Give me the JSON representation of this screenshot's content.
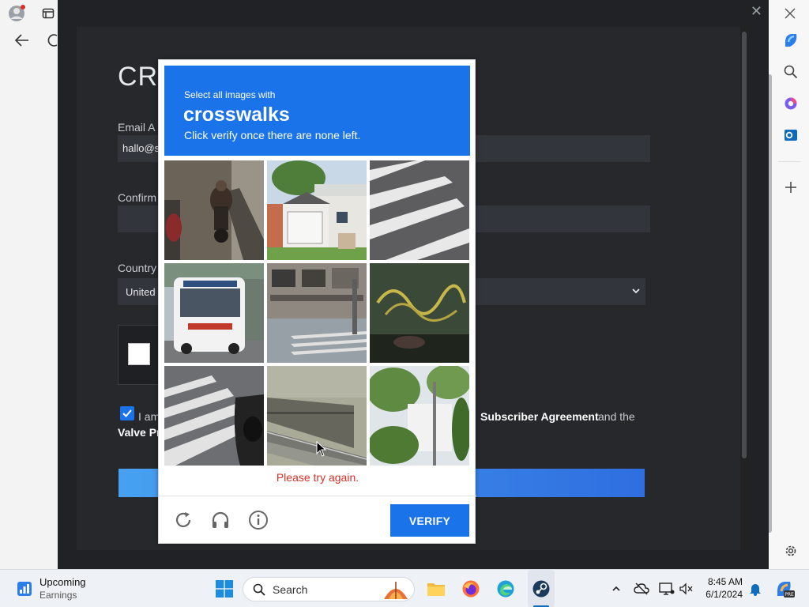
{
  "steam_form": {
    "title_partial": "CRE",
    "email_label_partial": "Email A",
    "email_value_partial": "hallo@s",
    "confirm_label_partial": "Confirm",
    "country_label_partial": "Country",
    "country_value_partial": "United",
    "agree_text_partial": "I am",
    "subscriber_agreement": "Subscriber Agreement",
    "and_the": "and the",
    "valve_privacy_partial": "Valve Pr"
  },
  "captcha": {
    "instruction_pre": "Select all images with",
    "target_object": "crosswalks",
    "instruction_post": "Click verify once there are none left.",
    "error_message": "Please try again.",
    "verify_label": "VERIFY",
    "tiles": [
      {
        "name": "tile-motorcyclists"
      },
      {
        "name": "tile-house"
      },
      {
        "name": "tile-crosswalk"
      },
      {
        "name": "tile-bus"
      },
      {
        "name": "tile-street-building"
      },
      {
        "name": "tile-graffiti-wall"
      },
      {
        "name": "tile-crosswalk-car"
      },
      {
        "name": "tile-bridge"
      },
      {
        "name": "tile-trees-building"
      }
    ]
  },
  "taskbar": {
    "widget_title": "Upcoming",
    "widget_subtitle": "Earnings",
    "search_label": "Search",
    "time": "8:45 AM",
    "date": "6/1/2024"
  },
  "colors": {
    "captcha_blue": "#1a73e8",
    "error_red": "#d93025",
    "steam_bg": "#202226"
  }
}
